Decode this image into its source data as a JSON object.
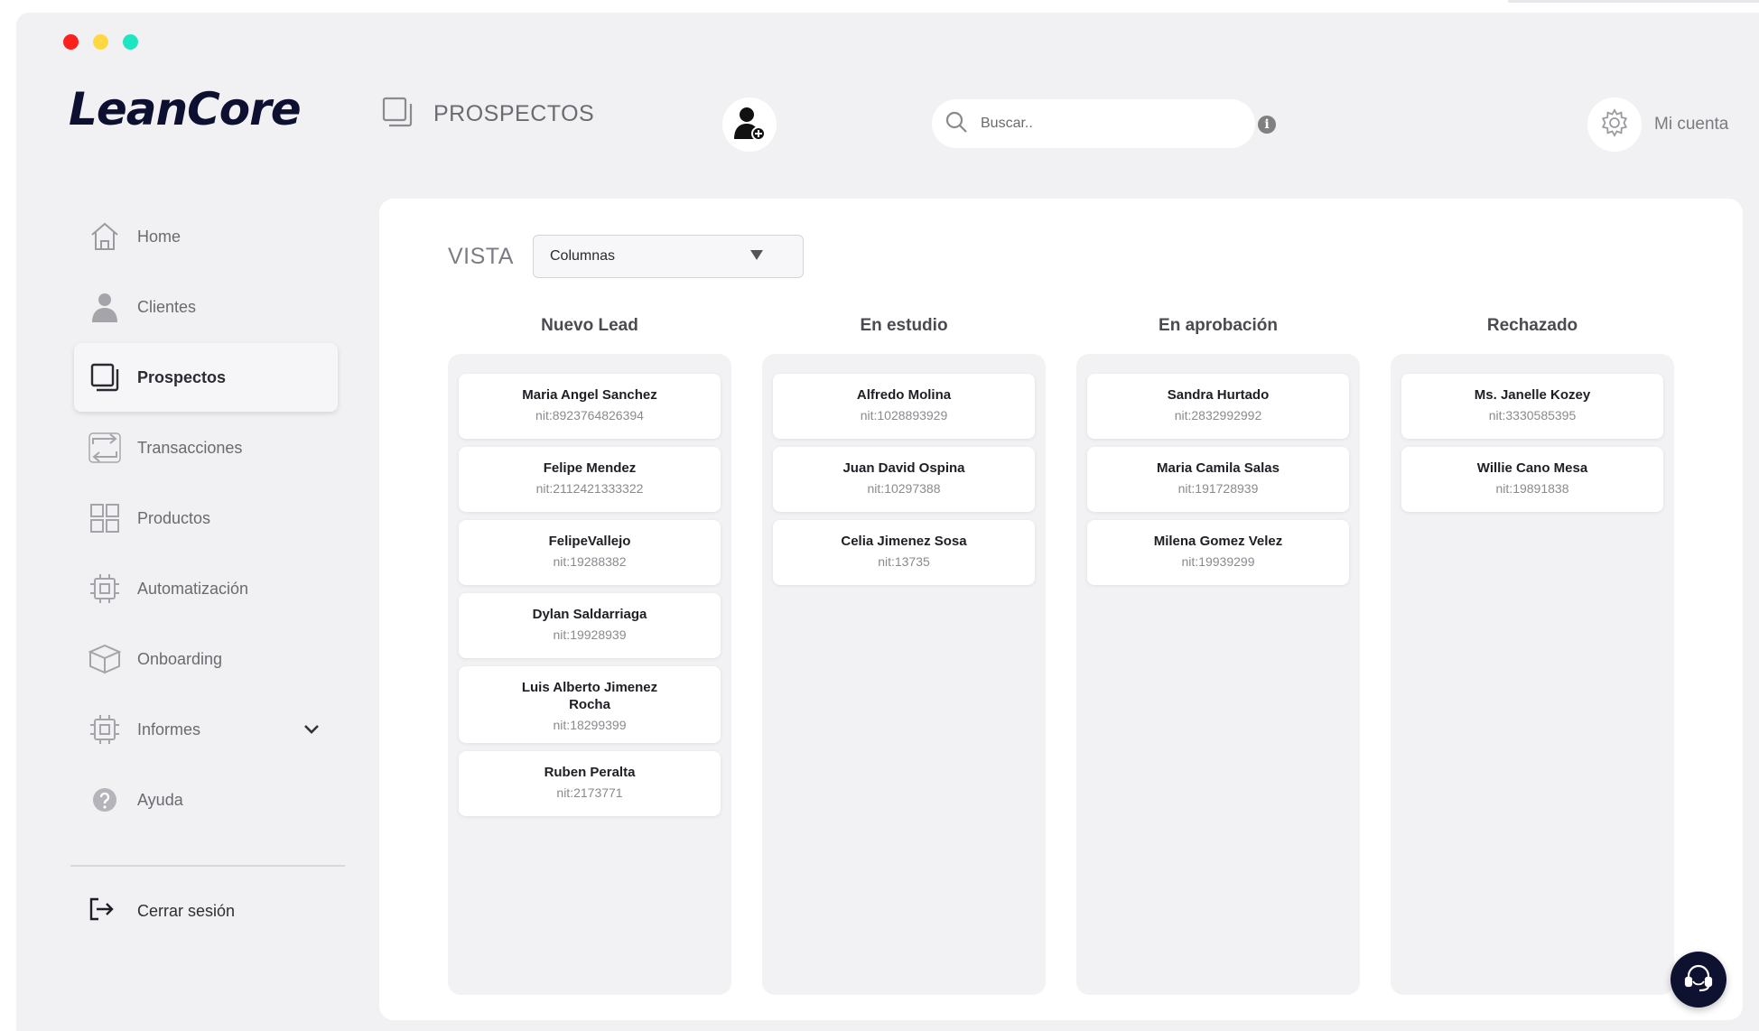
{
  "app": {
    "logo": "LeanCore"
  },
  "window": {
    "controls": [
      "close",
      "minimize",
      "maximize"
    ]
  },
  "header": {
    "title": "PROSPECTOS",
    "title_icon": "copy-icon",
    "add_prospect_icon": "user-add-icon",
    "search": {
      "placeholder": "Buscar..",
      "value": ""
    },
    "info_icon": "info-icon",
    "account_label": "Mi cuenta",
    "account_icon": "gear-icon"
  },
  "sidebar": {
    "items": [
      {
        "label": "Home",
        "icon": "home-icon"
      },
      {
        "label": "Clientes",
        "icon": "user-icon"
      },
      {
        "label": "Prospectos",
        "icon": "copy-icon",
        "active": true
      },
      {
        "label": "Transacciones",
        "icon": "transfer-icon"
      },
      {
        "label": "Productos",
        "icon": "grid-icon"
      },
      {
        "label": "Automatización",
        "icon": "cpu-icon"
      },
      {
        "label": "Onboarding",
        "icon": "box-icon"
      },
      {
        "label": "Informes",
        "icon": "cpu-icon",
        "expandable": true
      },
      {
        "label": "Ayuda",
        "icon": "help-icon"
      }
    ],
    "logout": {
      "label": "Cerrar sesión",
      "icon": "logout-icon"
    }
  },
  "view": {
    "label": "VISTA",
    "selected": "Columnas"
  },
  "columns": [
    {
      "title": "Nuevo Lead",
      "cards": [
        {
          "name": "Maria Angel Sanchez",
          "nit": "nit:8923764826394"
        },
        {
          "name": "Felipe Mendez",
          "nit": "nit:2112421333322"
        },
        {
          "name": "FelipeVallejo",
          "nit": "nit:19288382"
        },
        {
          "name": "Dylan Saldarriaga",
          "nit": "nit:19928939"
        },
        {
          "name": "Luis Alberto Jimenez Rocha",
          "nit": "nit:18299399"
        },
        {
          "name": "Ruben Peralta",
          "nit": "nit:2173771"
        }
      ]
    },
    {
      "title": "En estudio",
      "cards": [
        {
          "name": "Alfredo Molina",
          "nit": "nit:1028893929"
        },
        {
          "name": "Juan David Ospina",
          "nit": "nit:10297388"
        },
        {
          "name": "Celia Jimenez Sosa",
          "nit": "nit:13735"
        }
      ]
    },
    {
      "title": "En aprobación",
      "cards": [
        {
          "name": "Sandra Hurtado",
          "nit": "nit:2832992992"
        },
        {
          "name": "Maria Camila Salas",
          "nit": "nit:191728939"
        },
        {
          "name": "Milena Gomez Velez",
          "nit": "nit:19939299"
        }
      ]
    },
    {
      "title": "Rechazado",
      "cards": [
        {
          "name": "Ms. Janelle Kozey",
          "nit": "nit:3330585395"
        },
        {
          "name": "Willie Cano Mesa",
          "nit": "nit:19891838"
        }
      ]
    }
  ],
  "support_icon": "headset-icon"
}
